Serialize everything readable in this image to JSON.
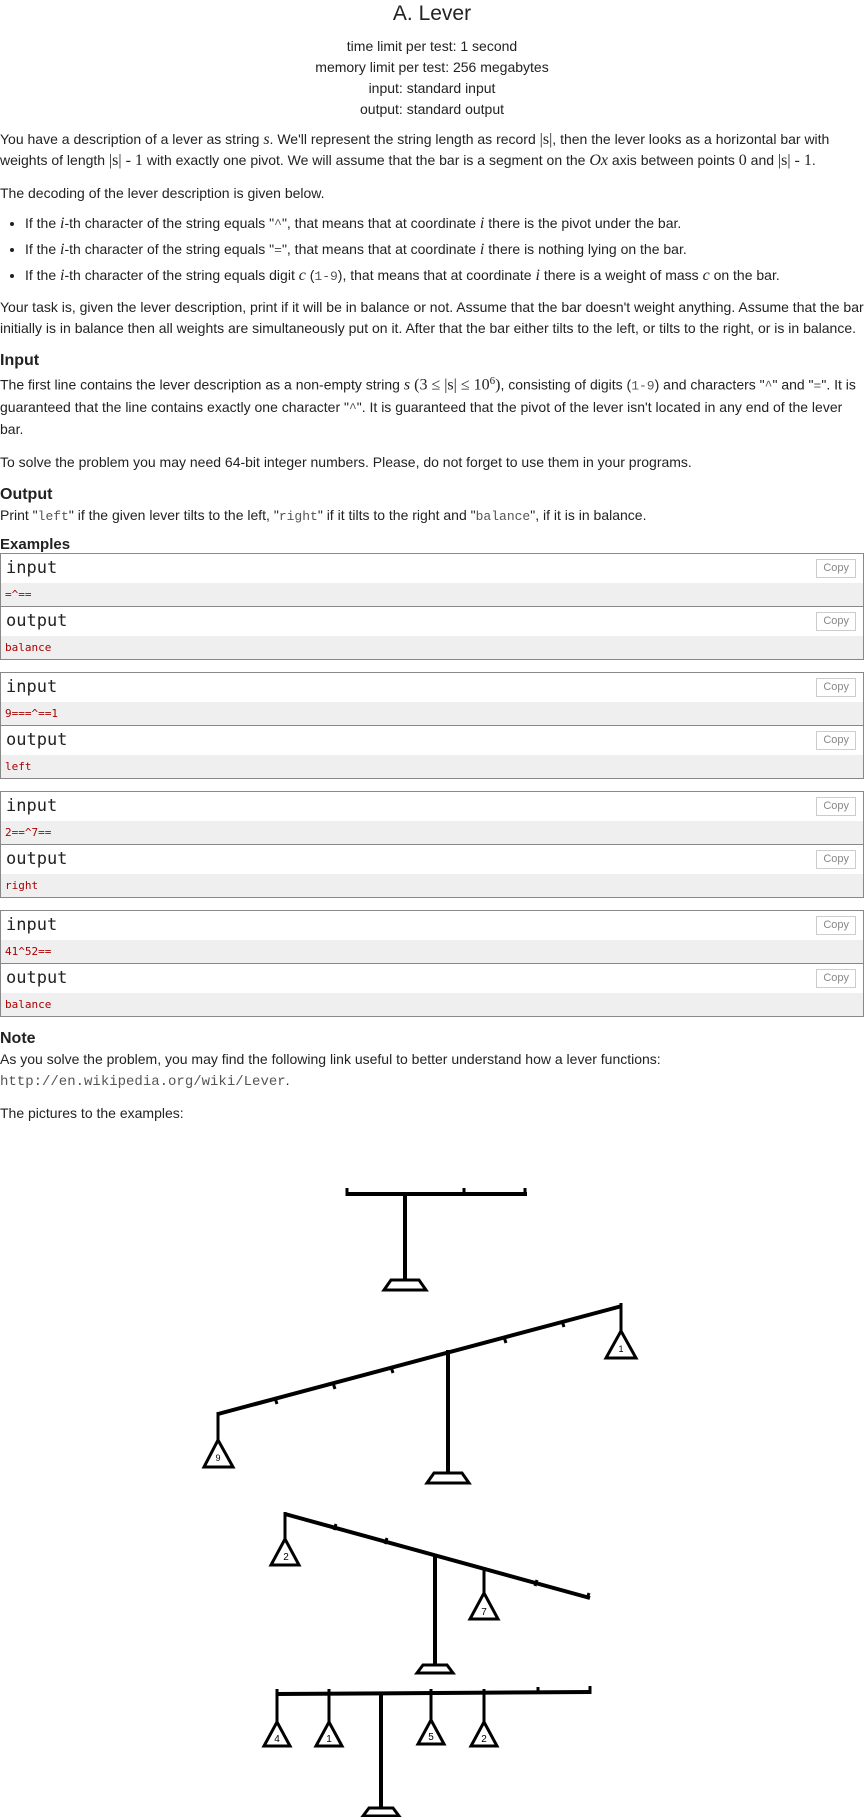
{
  "problem": {
    "title": "A. Lever",
    "time_limit": "time limit per test: 1 second",
    "memory_limit": "memory limit per test: 256 megabytes",
    "input_type": "input: standard input",
    "output_type": "output: standard output"
  },
  "statement": {
    "p1": {
      "a": "You have a description of a lever as string ",
      "s": "s",
      "b": ". We'll represent the string length as record ",
      "abs_s": "|s|",
      "c": ", then the lever looks as a horizontal bar with weights of length ",
      "len_expr": "|s| - 1",
      "d": " with exactly one pivot. We will assume that the bar is a segment on the ",
      "ox": "Ox",
      "e": " axis between points ",
      "zero": "0",
      "f": " and ",
      "end_expr": "|s| - 1",
      "g": "."
    },
    "p2": "The decoding of the lever description is given below.",
    "bullets": [
      {
        "a": "If the ",
        "i": "i",
        "b": "-th character of the string equals \"",
        "code": "^",
        "c": "\", that means that at coordinate ",
        "i2": "i",
        "d": " there is the pivot under the bar."
      },
      {
        "a": "If the ",
        "i": "i",
        "b": "-th character of the string equals \"",
        "code": "=",
        "c": "\", that means that at coordinate ",
        "i2": "i",
        "d": " there is nothing lying on the bar."
      },
      {
        "a": "If the ",
        "i": "i",
        "b": "-th character of the string equals digit ",
        "cvar": "c",
        "paren_open": " (",
        "code": "1-9",
        "paren_close": ")",
        "c": ", that means that at coordinate ",
        "i2": "i",
        "d": " there is a weight of mass ",
        "cvar2": "c",
        "e": " on the bar."
      }
    ],
    "p3": "Your task is, given the lever description, print if it will be in balance or not. Assume that the bar doesn't weight anything. Assume that the bar initially is in balance then all weights are simultaneously put on it. After that the bar either tilts to the left, or tilts to the right, or is in balance."
  },
  "input_section": {
    "title": "Input",
    "a": "The first line contains the lever description as a non-empty string ",
    "s": "s",
    "constraint": " (3 ≤ |s| ≤ 10",
    "exp": "6",
    "constraint_close": ")",
    "b": ", consisting of digits (",
    "digits": "1-9",
    "c": ") and characters \"",
    "caret": "^",
    "d": "\" and \"",
    "eq": "=",
    "e": "\". It is guaranteed that the line contains exactly one character \"",
    "caret2": "^",
    "f": "\". It is guaranteed that the pivot of the lever isn't located in any end of the lever bar.",
    "p2": "To solve the problem you may need 64-bit integer numbers. Please, do not forget to use them in your programs."
  },
  "output_section": {
    "title": "Output",
    "a": "Print \"",
    "left": "left",
    "b": "\" if the given lever tilts to the left, \"",
    "right": "right",
    "c": "\" if it tilts to the right and \"",
    "balance": "balance",
    "d": "\", if it is in balance."
  },
  "examples": {
    "title": "Examples",
    "input_label": "input",
    "output_label": "output",
    "copy_label": "Copy",
    "items": [
      {
        "input": "=^==",
        "output": "balance"
      },
      {
        "input": "9===^==1",
        "output": "left"
      },
      {
        "input": "2==^7==",
        "output": "right"
      },
      {
        "input": "41^52==",
        "output": "balance"
      }
    ]
  },
  "note": {
    "title": "Note",
    "text": "As you solve the problem, you may find the following link useful to better understand how a lever functions:",
    "link": "http://en.wikipedia.org/wiki/Lever",
    "link_suffix": ".",
    "pictures": "The pictures to the examples:"
  },
  "figures": {
    "lever1_weights": [],
    "lever2_weights": [
      {
        "label": "9"
      },
      {
        "label": "1"
      }
    ],
    "lever3_weights": [
      {
        "label": "2"
      },
      {
        "label": "7"
      }
    ],
    "lever4_weights": [
      {
        "label": "4"
      },
      {
        "label": "1"
      },
      {
        "label": "5"
      },
      {
        "label": "2"
      }
    ]
  }
}
